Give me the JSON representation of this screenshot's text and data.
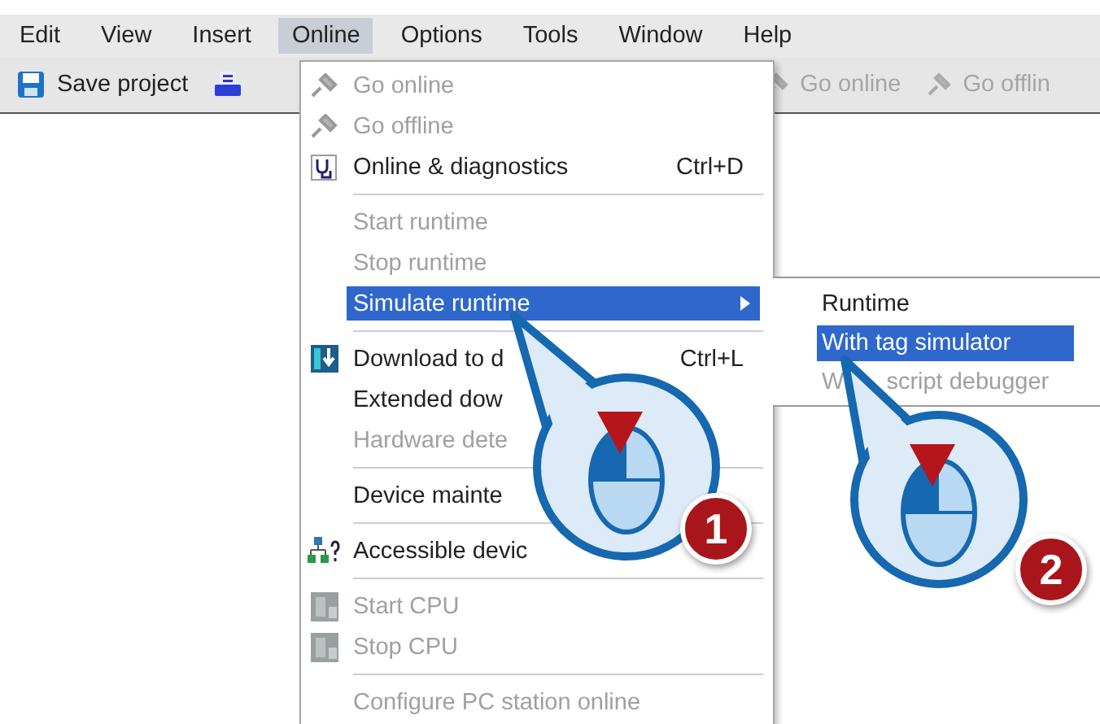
{
  "menu_bar": [
    {
      "label": "Edit",
      "selected": false
    },
    {
      "label": "View",
      "selected": false
    },
    {
      "label": "Insert",
      "selected": false
    },
    {
      "label": "Online",
      "selected": true
    },
    {
      "label": "Options",
      "selected": false
    },
    {
      "label": "Tools",
      "selected": false
    },
    {
      "label": "Window",
      "selected": false
    },
    {
      "label": "Help",
      "selected": false
    }
  ],
  "toolbar": {
    "save_label": "Save project",
    "right_items": [
      {
        "label": "Go online",
        "disabled": true
      },
      {
        "label": "Go offlin",
        "disabled": true
      }
    ]
  },
  "online_menu": [
    {
      "kind": "item",
      "label": "Go online",
      "disabled": true,
      "selected": false
    },
    {
      "kind": "item",
      "label": "Go offline",
      "disabled": true,
      "selected": false
    },
    {
      "kind": "item",
      "label": "Online & diagnostics",
      "shortcut": "Ctrl+D",
      "disabled": false,
      "selected": false
    },
    {
      "kind": "separator"
    },
    {
      "kind": "item",
      "label": "Start runtime",
      "disabled": true,
      "selected": false
    },
    {
      "kind": "item",
      "label": "Stop runtime",
      "disabled": true,
      "selected": false
    },
    {
      "kind": "item",
      "label": "Simulate runtime",
      "disabled": false,
      "selected": true,
      "has_submenu": true
    },
    {
      "kind": "separator"
    },
    {
      "kind": "item",
      "label": "Download to d",
      "shortcut": "Ctrl+L",
      "disabled": false,
      "selected": false
    },
    {
      "kind": "item",
      "label": "Extended dow",
      "disabled": false,
      "selected": false
    },
    {
      "kind": "item",
      "label": "Hardware dete",
      "disabled": true,
      "selected": false
    },
    {
      "kind": "separator"
    },
    {
      "kind": "item",
      "label": "Device mainte",
      "disabled": false,
      "selected": false
    },
    {
      "kind": "separator"
    },
    {
      "kind": "item",
      "label": "Accessible devic",
      "disabled": false,
      "selected": false
    },
    {
      "kind": "separator"
    },
    {
      "kind": "item",
      "label": "Start CPU",
      "disabled": true,
      "selected": false
    },
    {
      "kind": "item",
      "label": "Stop CPU",
      "disabled": true,
      "selected": false
    },
    {
      "kind": "separator"
    },
    {
      "kind": "item",
      "label": "Configure PC station online",
      "disabled": true,
      "selected": false
    }
  ],
  "submenu": [
    {
      "label": "Runtime",
      "disabled": false,
      "selected": false
    },
    {
      "label": "With tag simulator",
      "disabled": false,
      "selected": true
    },
    {
      "label": "W",
      "label_rest": "script debugger",
      "disabled": true,
      "selected": false
    }
  ],
  "callouts": [
    {
      "number": "1"
    },
    {
      "number": "2"
    }
  ]
}
